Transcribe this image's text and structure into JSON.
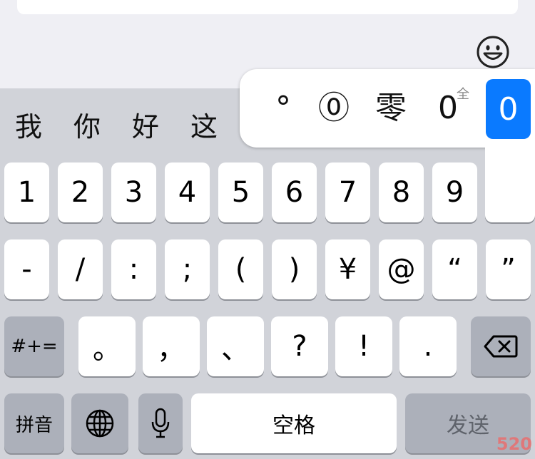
{
  "candidates": [
    "我",
    "你",
    "好",
    "这"
  ],
  "popup": {
    "variants": [
      "°",
      "⓪",
      "零",
      "0"
    ],
    "superscript": "全",
    "selected": "0"
  },
  "row1": [
    "1",
    "2",
    "3",
    "4",
    "5",
    "6",
    "7",
    "8",
    "9"
  ],
  "row2": [
    "-",
    "/",
    ":",
    ";",
    "(",
    ")",
    "¥",
    "@",
    "“",
    "”"
  ],
  "row3": {
    "toggle": "#+=",
    "keys": [
      "。",
      "，",
      "、",
      "?",
      "!",
      "."
    ],
    "delete_icon": "delete-icon"
  },
  "row4": {
    "mode": "拼音",
    "globe_icon": "globe-icon",
    "mic_icon": "microphone-icon",
    "space": "空格",
    "send": "发送"
  },
  "watermark": "520",
  "colors": {
    "keyboard_bg": "#d1d3d9",
    "key_bg": "#ffffff",
    "function_key_bg": "#acb0ba",
    "selected_bg": "#0a7aff"
  }
}
